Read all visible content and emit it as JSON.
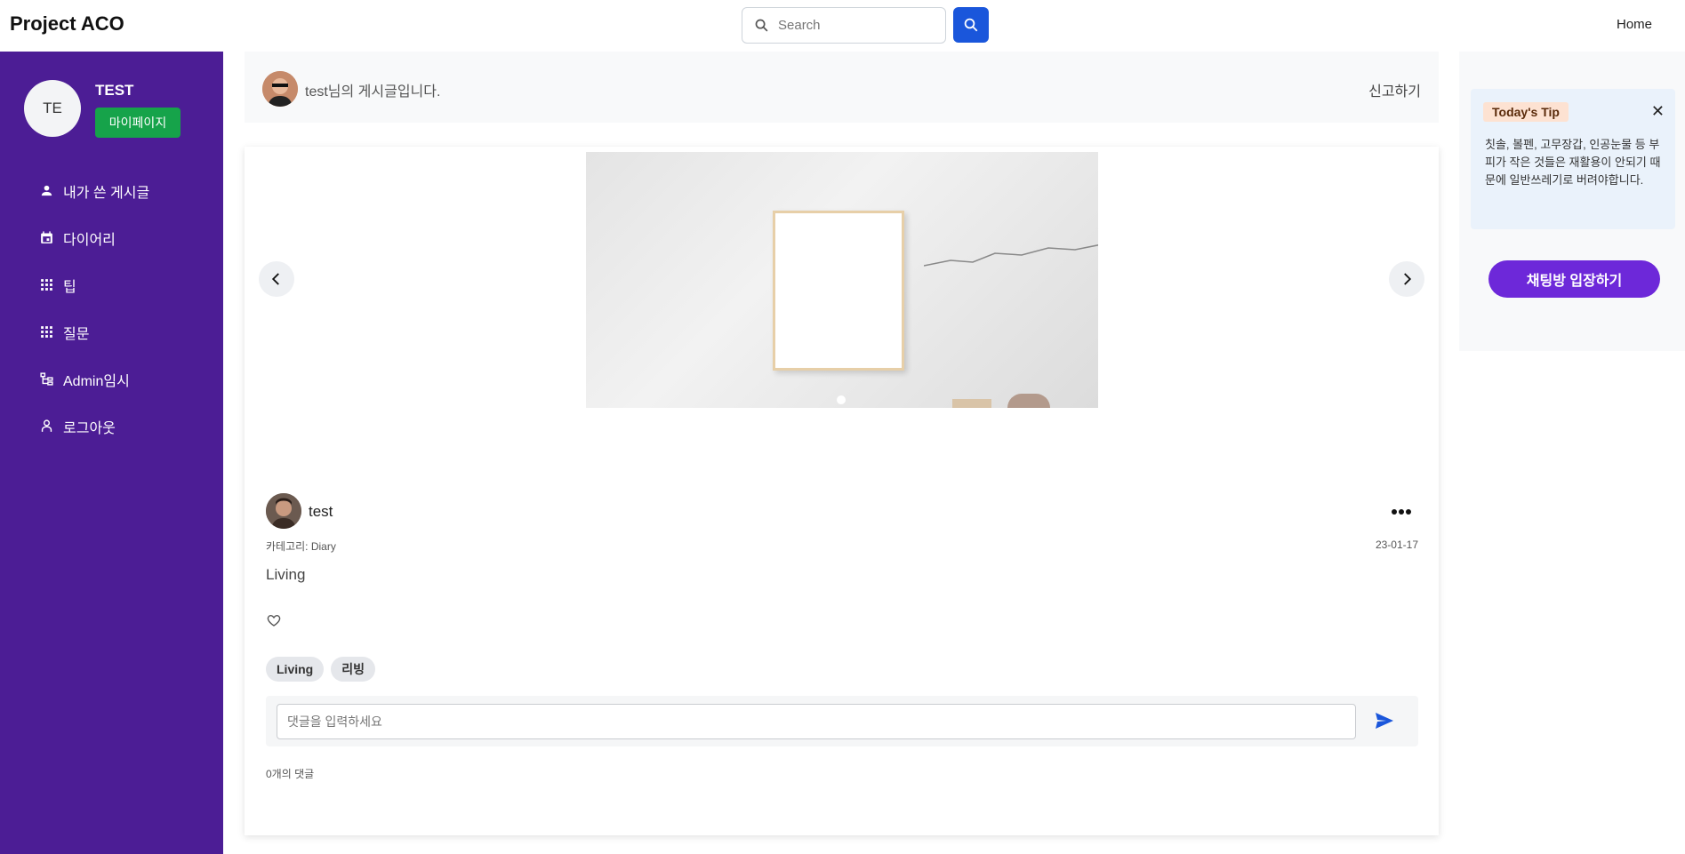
{
  "header": {
    "brand": "Project ACO",
    "search_placeholder": "Search",
    "nav_home": "Home"
  },
  "sidebar": {
    "avatar_initials": "TE",
    "username": "TEST",
    "mypage_label": "마이페이지",
    "items": [
      {
        "label": "내가 쓴 게시글",
        "icon": "person-icon"
      },
      {
        "label": "다이어리",
        "icon": "calendar-icon"
      },
      {
        "label": "팁",
        "icon": "grid-icon"
      },
      {
        "label": "질문",
        "icon": "grid-icon"
      },
      {
        "label": "Admin임시",
        "icon": "admin-tree-icon"
      },
      {
        "label": "로그아웃",
        "icon": "person-outline-icon"
      }
    ]
  },
  "post_header": {
    "title": "test님의 게시글입니다.",
    "report_label": "신고하기"
  },
  "post": {
    "author": "test",
    "category": "카테고리: Diary",
    "date": "23-01-17",
    "body": "Living",
    "tags": [
      "Living",
      "리빙"
    ],
    "comment_placeholder": "댓글을 입력하세요",
    "comment_count": "0개의 댓글"
  },
  "tip": {
    "title": "Today's Tip",
    "close": "✕",
    "text": "칫솔, 볼펜, 고무장갑, 인공눈물 등 부피가 작은 것들은 재활용이 안되기 때문에 일반쓰레기로 버려야합니다."
  },
  "chat_button": "채팅방 입장하기",
  "colors": {
    "sidebar_bg": "#4c1d95",
    "primary_blue": "#1a56db",
    "mypage_green": "#16a34a",
    "chat_purple": "#6d28d9"
  }
}
